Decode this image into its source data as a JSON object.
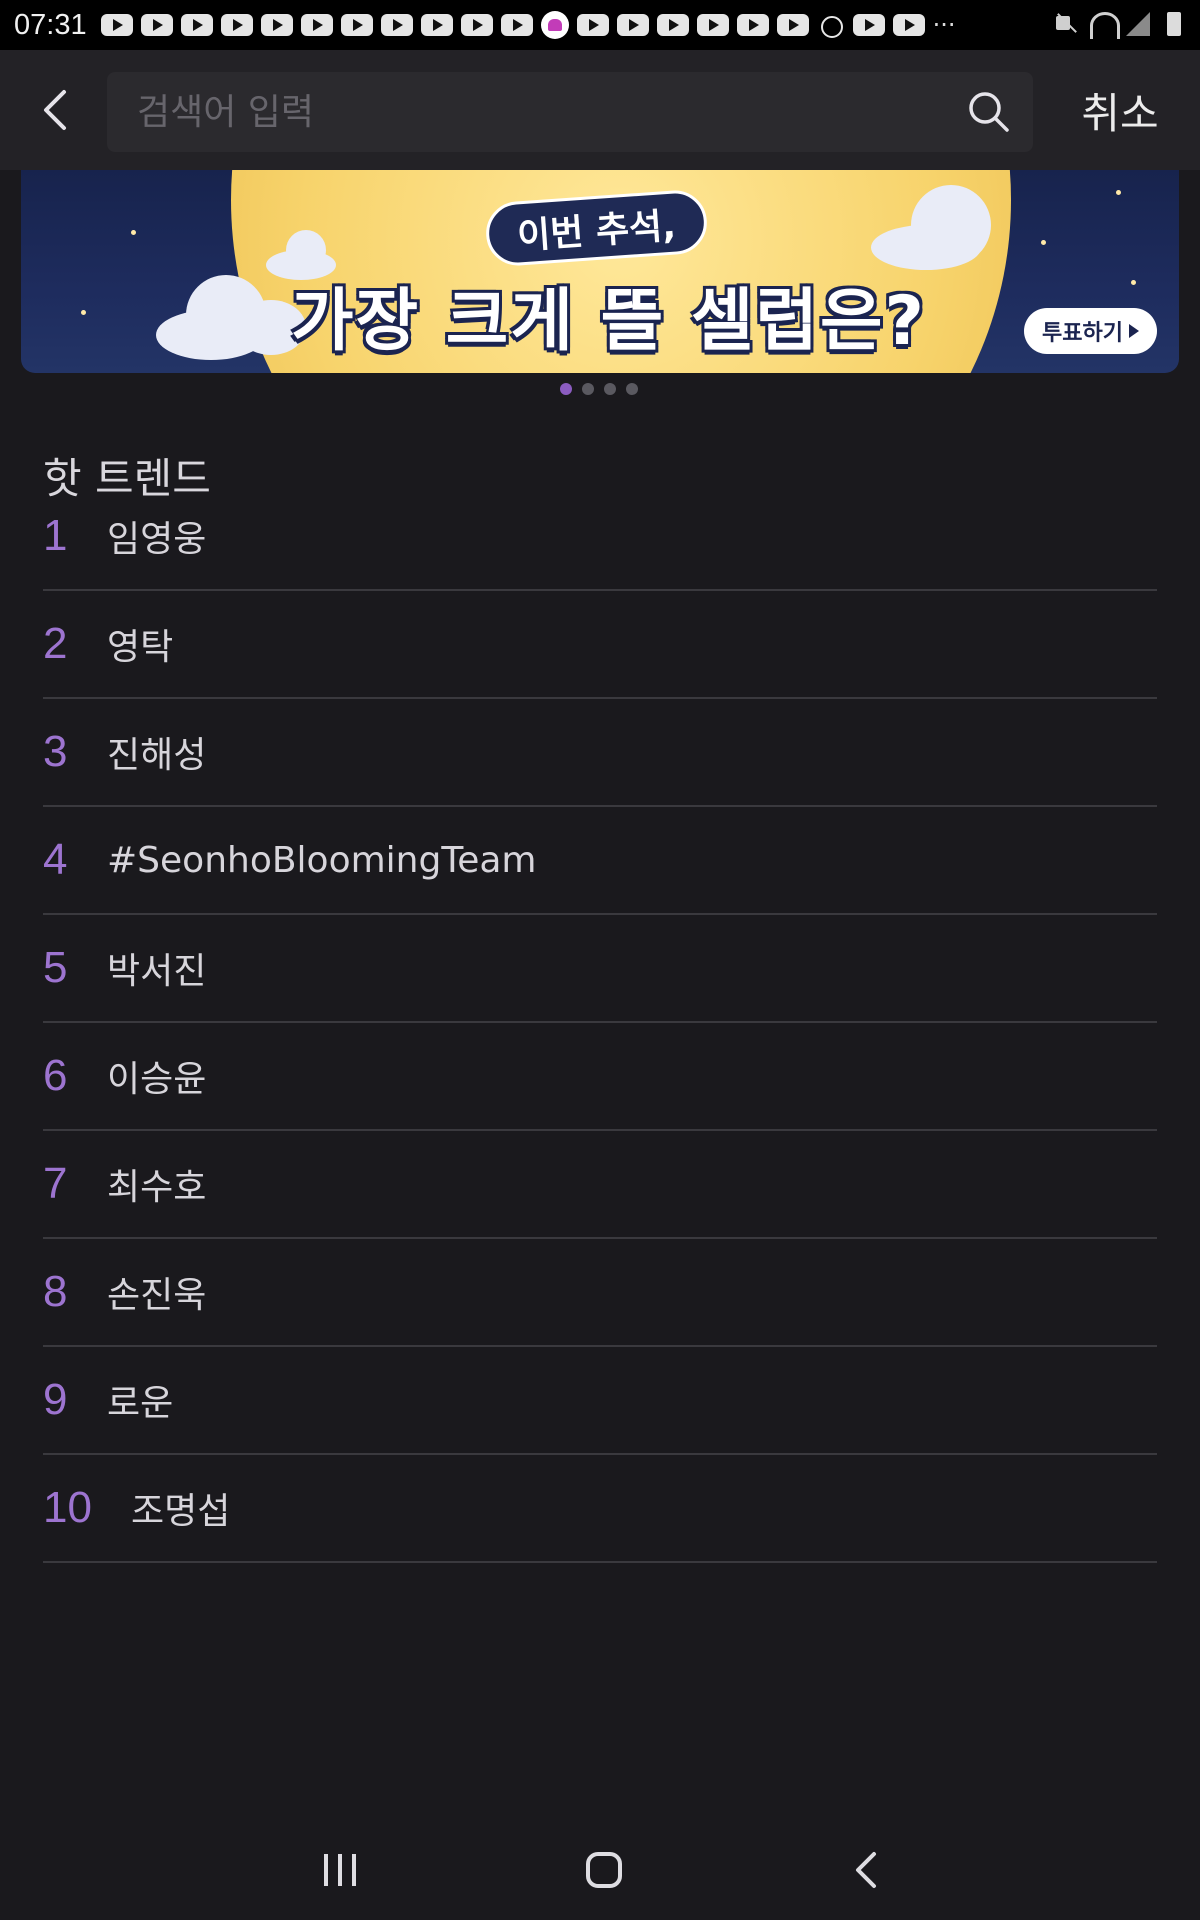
{
  "status_bar": {
    "time": "07:31",
    "notification_count": 22
  },
  "search": {
    "placeholder": "검색어 입력",
    "cancel_label": "취소"
  },
  "banner": {
    "subtitle": "이번 추석,",
    "title": "가장 크게 뜰 셀럽은?",
    "vote_label": "투표하기",
    "page_count": 4,
    "active_page": 1
  },
  "trends": {
    "title": "핫 트렌드",
    "items": [
      {
        "rank": "1",
        "keyword": "임영웅"
      },
      {
        "rank": "2",
        "keyword": "영탁"
      },
      {
        "rank": "3",
        "keyword": "진해성"
      },
      {
        "rank": "4",
        "keyword": "#SeonhoBloomingTeam"
      },
      {
        "rank": "5",
        "keyword": "박서진"
      },
      {
        "rank": "6",
        "keyword": "이승윤"
      },
      {
        "rank": "7",
        "keyword": "최수호"
      },
      {
        "rank": "8",
        "keyword": "손진욱"
      },
      {
        "rank": "9",
        "keyword": "로운"
      },
      {
        "rank": "10",
        "keyword": "조명섭"
      }
    ]
  },
  "colors": {
    "accent": "#9d74d0",
    "background": "#1a191d",
    "header": "#232226"
  }
}
